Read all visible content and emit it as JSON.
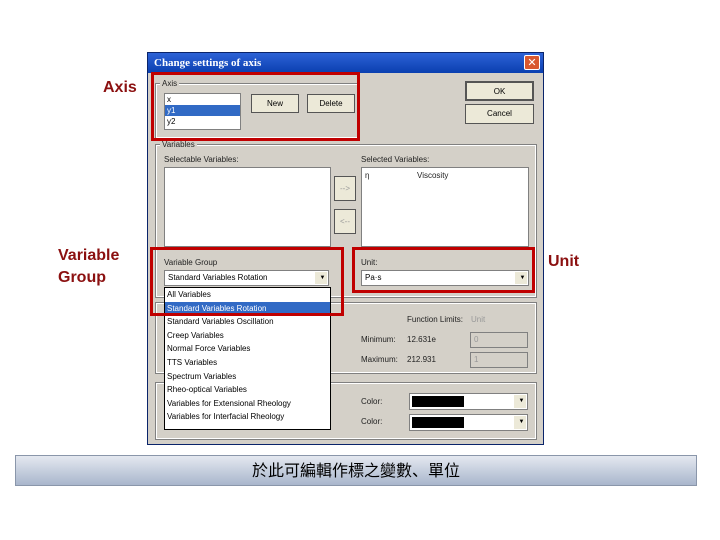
{
  "annotations": {
    "axis": "Axis",
    "variable_group": "Variable Group",
    "unit": "Unit"
  },
  "dialog": {
    "title": "Change settings of axis",
    "axis": {
      "label": "Axis",
      "items": [
        "x",
        "y1",
        "y2"
      ],
      "selected": "y1",
      "new": "New",
      "delete": "Delete"
    },
    "ok": "OK",
    "cancel": "Cancel",
    "variables": {
      "label": "Variables",
      "selectable_label": "Selectable Variables:",
      "selected_label": "Selected Variables:",
      "selected_items": [
        {
          "symbol": "η",
          "name": "Viscosity"
        }
      ],
      "add": "-->",
      "remove": "<--"
    },
    "variable_group": {
      "label": "Variable Group",
      "value": "Standard Variables Rotation",
      "options": [
        "All Variables",
        "Standard Variables Rotation",
        "Standard Variables Oscillation",
        "Creep Variables",
        "Normal Force Variables",
        "TTS Variables",
        "Spectrum Variables",
        "Rheo-optical Variables",
        "Variables for Extensional Rheology",
        "Variables for Interfacial Rheology"
      ]
    },
    "unit": {
      "label": "Unit:",
      "value": "Pa·s"
    },
    "limits": {
      "label": "Function Limits:",
      "unit": "Unit",
      "min_label": "Minimum:",
      "min_value": "12.631e",
      "min_input": "0",
      "max_label": "Maximum:",
      "max_value": "212.931",
      "max_input": "1"
    },
    "colors": [
      {
        "label": "Color:",
        "value": "#000000"
      },
      {
        "label": "Color:",
        "value": "#000000"
      }
    ]
  },
  "banner": "於此可編輯作標之變數、單位"
}
